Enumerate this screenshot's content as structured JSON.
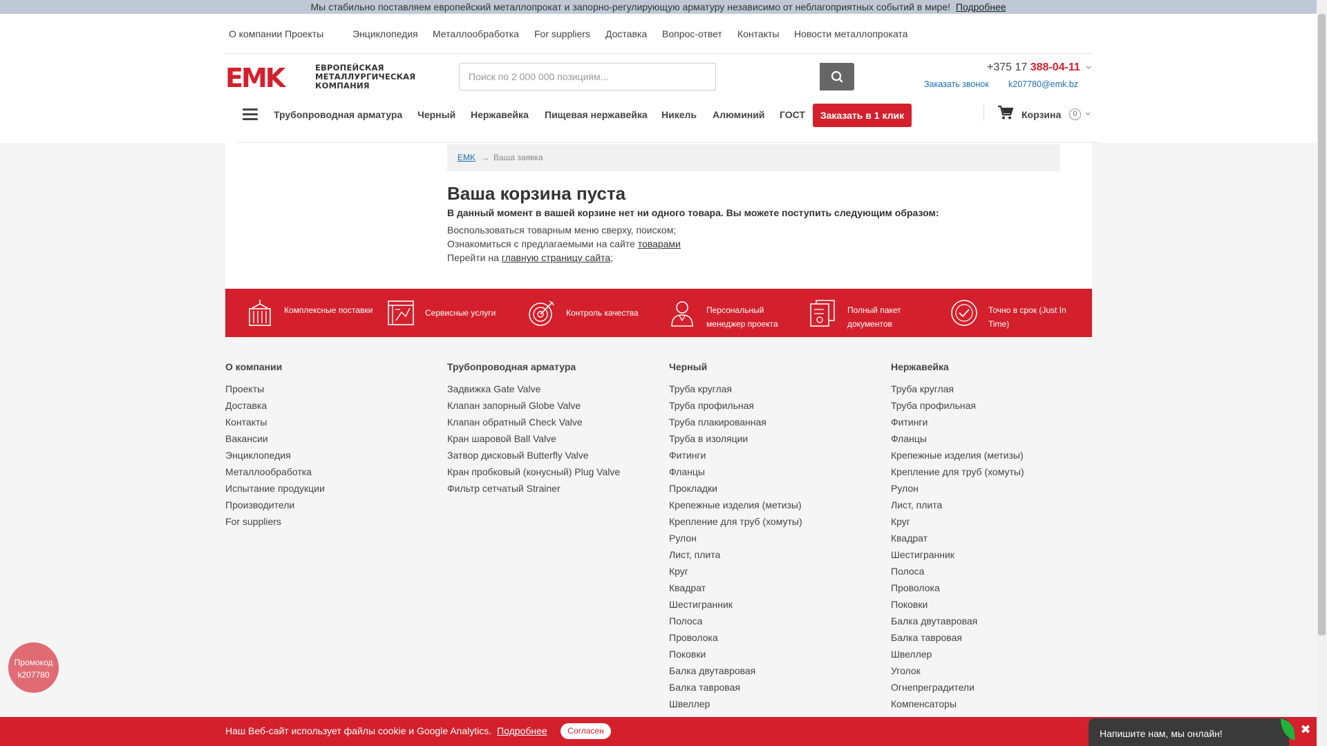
{
  "banner": {
    "text": "Мы стабильно поставляем европейский металлопрокат и запорно-регулирующую арматуру независимо от неблагоприятных событий в мире!",
    "more": "Подробнее"
  },
  "topnav": [
    "О компании",
    "Проекты",
    "Энциклопедия",
    "Металлообработка",
    "For suppliers",
    "Доставка",
    "Вопрос-ответ",
    "Контакты",
    "Новости металлопроката"
  ],
  "logo": {
    "mark": "EMK",
    "line1": "ЕВРОПЕЙСКАЯ",
    "line2": "МЕТАЛЛУРГИЧЕСКАЯ",
    "line3": "КОМПАНИЯ"
  },
  "search": {
    "placeholder": "Поиск по 2 000 000 позициям..."
  },
  "contact": {
    "phone_prefix": "+375 17",
    "phone_number": "388-04-11",
    "callback": "Заказать звонок",
    "email": "k207780@emk.bz"
  },
  "catnav": {
    "items": [
      "Трубопроводная арматура",
      "Черный",
      "Нержавейка",
      "Пищевая нержавейка",
      "Никель",
      "Алюминий",
      "ГОСТ"
    ],
    "order_button": "Заказать в 1 клик",
    "cart_label": "Корзина",
    "cart_count": "0"
  },
  "breadcrumb": {
    "home": "EMK",
    "arrow": "→",
    "current": "Ваша заявка"
  },
  "cart_empty": {
    "title": "Ваша корзина пуста",
    "lead": "В данный момент в вашей корзине нет ни одного товара. Вы можете поступить следующим образом:",
    "line1": "Воспользоваться товарным меню сверху, поиском;",
    "line2_prefix": "Ознакомиться с предлагаемыми на сайте ",
    "line2_link": "товарами",
    "line3_prefix": "Перейти на ",
    "line3_link": "главную страницу сайта",
    "line3_suffix": ";"
  },
  "features": [
    {
      "icon": "container-icon",
      "text": "Комплексные поставки"
    },
    {
      "icon": "blueprint-icon",
      "text": "Сервисные услуги"
    },
    {
      "icon": "target-icon",
      "text": "Контроль качества"
    },
    {
      "icon": "manager-icon",
      "text": "Персональный менеджер проекта"
    },
    {
      "icon": "documents-icon",
      "text": "Полный пакет документов"
    },
    {
      "icon": "clock-check-icon",
      "text": "Точно в срок (Just In Time)"
    }
  ],
  "footer": {
    "columns": [
      {
        "title": "О компании",
        "links": [
          "Проекты",
          "Доставка",
          "Контакты",
          "Вакансии",
          "Энциклопедия",
          "Металлообработка",
          "Испытание продукции",
          "Производители",
          "For suppliers"
        ]
      },
      {
        "title": "Трубопроводная арматура",
        "links": [
          "Задвижка Gate Valve",
          "Клапан запорный Globe Valve",
          "Клапан обратный Check Valve",
          "Кран шаровой Ball Valve",
          "Затвор дисковый Butterfly Valve",
          "Кран пробковый (конусный) Plug Valve",
          "Фильтр сетчатый Strainer"
        ]
      },
      {
        "title": "Черный",
        "links": [
          "Труба круглая",
          "Труба профильная",
          "Труба плакированная",
          "Труба в изоляции",
          "Фитинги",
          "Фланцы",
          "Прокладки",
          "Крепежные изделия (метизы)",
          "Крепление для труб (хомуты)",
          "Рулон",
          "Лист, плита",
          "Круг",
          "Квадрат",
          "Шестигранник",
          "Полоса",
          "Проволока",
          "Поковки",
          "Балка двутавровая",
          "Балка тавровая",
          "Швеллер"
        ]
      },
      {
        "title": "Нержавейка",
        "links": [
          "Труба круглая",
          "Труба профильная",
          "Фитинги",
          "Фланцы",
          "Крепежные изделия (метизы)",
          "Крепление для труб (хомуты)",
          "Рулон",
          "Лист, плита",
          "Круг",
          "Квадрат",
          "Шестигранник",
          "Полоса",
          "Проволока",
          "Поковки",
          "Балка двутавровая",
          "Балка тавровая",
          "Швеллер",
          "Уголок",
          "Огнепреградители",
          "Компенсаторы"
        ]
      }
    ]
  },
  "promo": {
    "line1": "Промокод",
    "line2": "k207780"
  },
  "cookie": {
    "text": "Наш Веб-сайт использует файлы cookie и Google Analytics.",
    "more": "Подробнее",
    "agree": "Согласен"
  },
  "chat": {
    "text": "Напишите нам, мы онлайн!",
    "close": "✖"
  },
  "colors": {
    "brand": "#d3202c",
    "link": "#1a6eb7"
  }
}
